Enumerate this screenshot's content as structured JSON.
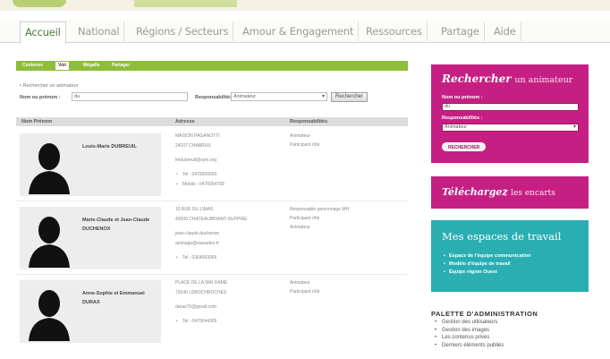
{
  "main_nav": [
    "Accueil",
    "National",
    "Régions / Secteurs",
    "Amour & Engagement",
    "Ressources",
    "Partage",
    "Aide"
  ],
  "sub_tabs": [
    "Contenus",
    "Voir",
    "Mégafie",
    "Partager"
  ],
  "search_form": {
    "legend": "Rechercher un animateur",
    "name_label": "Nom ou prénom :",
    "name_value": "du",
    "resp_label": "Responsabilités :",
    "resp_value": "Animateur",
    "button": "Rechercher"
  },
  "table": {
    "headers": [
      "Nom Prénom",
      "Adresse",
      "Responsabilités"
    ],
    "rows": [
      {
        "name": "Louis-Marie DUBREUIL",
        "addr1": "MAISON PAGANOTTI",
        "addr2": "24107 CHABRUIL",
        "email": "lmdubreuil@sym.org",
        "tel": "Tel : 0479000000",
        "mobile": "Mobile : 0470094799",
        "resp": [
          "Animateur",
          "Participant rôle"
        ]
      },
      {
        "name": "Marie-Claude et Jean-Claude DUCHENOX",
        "addr1": "10 RUE DU LIMAS",
        "addr2": "49000 CHATEAUBRIANT-SUPPIRE",
        "email1": "jean-claude.duchenon",
        "email2": "animage@wanadoo.fr",
        "tel": "Tel : 0364663066",
        "resp": [
          "Responsable personnage MH",
          "Participant rôle",
          "Animateur"
        ]
      },
      {
        "name": "Anne-Sophie et Emmanuel DURAX",
        "addr1": "PLACE DE LA MAI DAME",
        "addr2": "72040 LEBOCHROCHES",
        "email": "durax70@gmail.com",
        "tel": "Tel : 0470044305",
        "resp": [
          "Animateur",
          "Participant rôle"
        ]
      }
    ]
  },
  "sidebar": {
    "search_box": {
      "title_bold": "Rechercher",
      "title_rest": "un animateur",
      "name_label": "Nom ou prénom :",
      "name_value": "du",
      "resp_label": "Responsabilités :",
      "resp_value": "Animateur",
      "button": "RECHERCHER"
    },
    "download_box": {
      "title_bold": "Téléchargez",
      "title_rest": "les encarts"
    },
    "workspace_box": {
      "title": "Mes espaces de travail",
      "items": [
        "Espace de l'équipe communication",
        "Modèle d'équipe de travail",
        "Équipe région Ouest"
      ]
    },
    "admin": {
      "title": "PALETTE D'ADMINISTRATION",
      "items": [
        "Gestion des utilisateurs",
        "Gestion des images",
        "Les contenus privés",
        "Derniers éléments publiés"
      ]
    }
  },
  "colors": {
    "magenta": "#c51f83",
    "teal": "#2aaeb2",
    "green": "#8ebd3a"
  }
}
